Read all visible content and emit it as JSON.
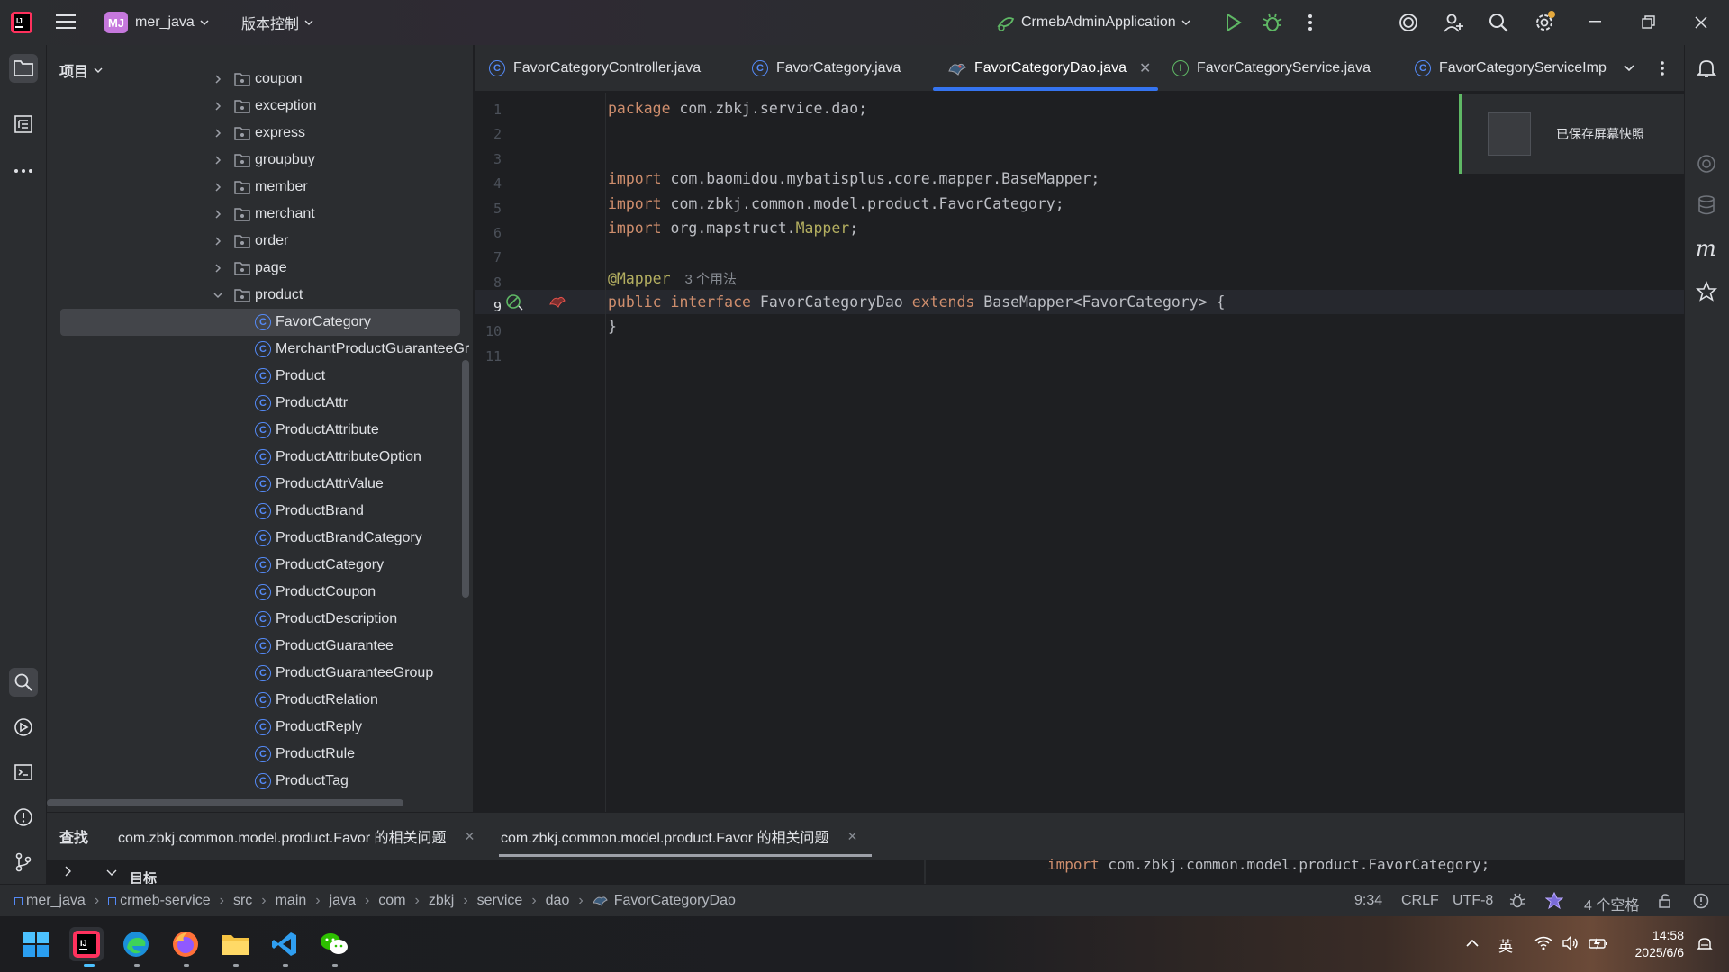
{
  "titlebar": {
    "project_badge": "MJ",
    "project_name": "mer_java",
    "vcs_label": "版本控制",
    "run_config": "CrmebAdminApplication"
  },
  "project_panel": {
    "title": "项目",
    "folders": [
      {
        "label": "coupon",
        "expanded": false
      },
      {
        "label": "exception",
        "expanded": false
      },
      {
        "label": "express",
        "expanded": false
      },
      {
        "label": "groupbuy",
        "expanded": false
      },
      {
        "label": "member",
        "expanded": false
      },
      {
        "label": "merchant",
        "expanded": false
      },
      {
        "label": "order",
        "expanded": false
      },
      {
        "label": "page",
        "expanded": false
      },
      {
        "label": "product",
        "expanded": true
      }
    ],
    "classes": [
      {
        "label": "FavorCategory",
        "selected": true
      },
      {
        "label": "MerchantProductGuaranteeGr"
      },
      {
        "label": "Product"
      },
      {
        "label": "ProductAttr"
      },
      {
        "label": "ProductAttribute"
      },
      {
        "label": "ProductAttributeOption"
      },
      {
        "label": "ProductAttrValue"
      },
      {
        "label": "ProductBrand"
      },
      {
        "label": "ProductBrandCategory"
      },
      {
        "label": "ProductCategory"
      },
      {
        "label": "ProductCoupon"
      },
      {
        "label": "ProductDescription"
      },
      {
        "label": "ProductGuarantee"
      },
      {
        "label": "ProductGuaranteeGroup"
      },
      {
        "label": "ProductRelation"
      },
      {
        "label": "ProductReply"
      },
      {
        "label": "ProductRule"
      },
      {
        "label": "ProductTag"
      }
    ]
  },
  "tabs": [
    {
      "label": "FavorCategoryController.java",
      "icon": "class-icon",
      "active": false
    },
    {
      "label": "FavorCategory.java",
      "icon": "class-icon",
      "active": false
    },
    {
      "label": "FavorCategoryDao.java",
      "icon": "mybatis-icon",
      "active": true
    },
    {
      "label": "FavorCategoryService.java",
      "icon": "interface-icon",
      "active": false
    },
    {
      "label": "FavorCategoryServiceImp",
      "icon": "class-icon",
      "active": false
    }
  ],
  "editor": {
    "line_numbers": [
      "1",
      "2",
      "3",
      "4",
      "5",
      "6",
      "7",
      "8",
      "9",
      "10",
      "11"
    ],
    "line1_kw": "package",
    "line1_rest": " com.zbkj.service.dao;",
    "line4_kw": "import",
    "line4_rest": " com.baomidou.mybatisplus.core.mapper.BaseMapper;",
    "line5_kw": "import",
    "line5_rest": " com.zbkj.common.model.product.FavorCategory;",
    "line6_kw": "import",
    "line6_pre": " org.mapstruct.",
    "line6_ann": "Mapper",
    "line6_end": ";",
    "line8_ann": "@Mapper",
    "line8_hint": "3 个用法",
    "line9_kw1": "public",
    "line9_kw2": "interface",
    "line9_name": "FavorCategoryDao",
    "line9_kw3": "extends",
    "line9_rest": "BaseMapper<FavorCategory> {",
    "line10": "}"
  },
  "toast": {
    "text": "已保存屏幕快照"
  },
  "find_panel": {
    "label": "查找",
    "tabs": [
      "com.zbkj.common.model.product.Favor 的相关问题",
      "com.zbkj.common.model.product.Favor 的相关问题"
    ],
    "target_label": "目标",
    "preview": "import com.zbkj.common.model.product.FavorCategory;"
  },
  "statusbar": {
    "breadcrumbs": [
      "mer_java",
      "crmeb-service",
      "src",
      "main",
      "java",
      "com",
      "zbkj",
      "service",
      "dao",
      "FavorCategoryDao"
    ],
    "position": "9:34",
    "line_sep": "CRLF",
    "encoding": "UTF-8",
    "indent": "4 个空格"
  },
  "taskbar": {
    "ime": "英",
    "time": "14:58",
    "date": "2025/6/6"
  },
  "colors": {
    "accent": "#3574f0",
    "keyword": "#cf8e6d",
    "annotation": "#b3ae60",
    "success": "#5fb865"
  }
}
